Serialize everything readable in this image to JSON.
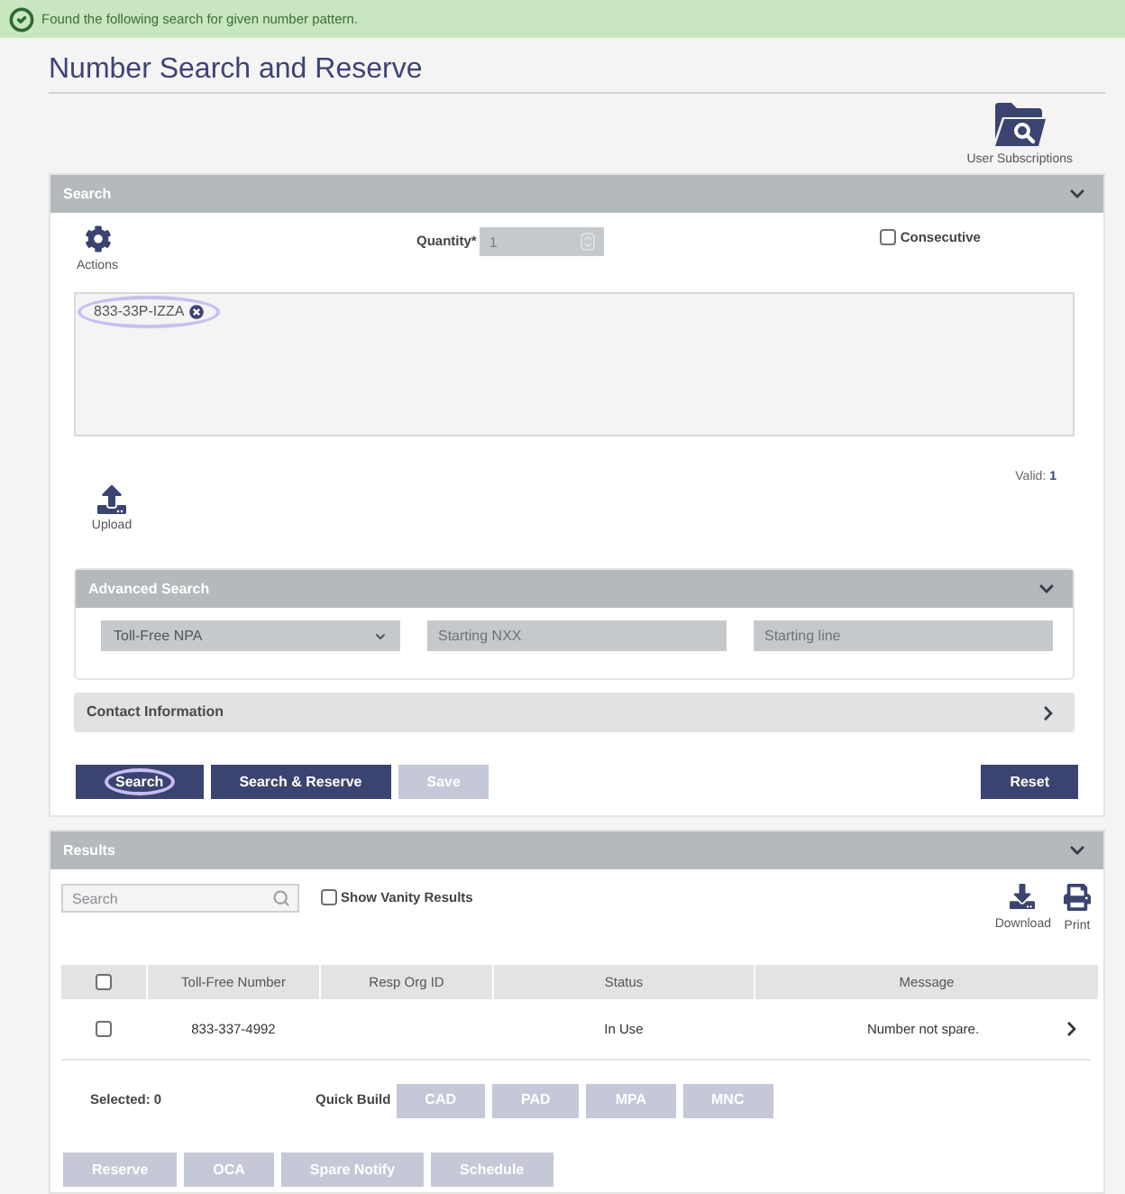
{
  "alert": {
    "kind": "success",
    "message": "Found the following search for given number pattern."
  },
  "page_title": "Number Search and Reserve",
  "header_tools": [
    {
      "kind": "subscriptions",
      "label": "User Subscriptions"
    }
  ],
  "search_panel": {
    "title": "Search",
    "expanded": true,
    "actions_label": "Actions",
    "quantity": {
      "label": "Quantity*",
      "value": "1",
      "disabled": true
    },
    "consecutive": {
      "label": "Consecutive",
      "checked": false
    },
    "patterns": [
      {
        "text": "833-33P-IZZA",
        "focused": true
      }
    ],
    "valid_text": "Valid: **1**",
    "upload_label": "Upload",
    "advanced_search": {
      "title": "Advanced Search",
      "expanded": true,
      "npa_select": {
        "value": "Toll-Free NPA"
      },
      "fields": [
        {
          "placeholder": "Starting NXX"
        },
        {
          "placeholder": "Starting line"
        }
      ]
    },
    "contact_information": {
      "title": "Contact Information",
      "expanded": false
    },
    "buttons": [
      {
        "label": "Search",
        "disabled": false,
        "focused": true
      },
      {
        "label": "Search & Reserve",
        "disabled": false,
        "focused": false
      },
      {
        "label": "Save",
        "disabled": true,
        "focused": false
      }
    ],
    "reset_button": {
      "label": "Reset",
      "disabled": false
    }
  },
  "results_panel": {
    "title": "Results",
    "expanded": true,
    "search": {
      "placeholder": "Search"
    },
    "show_vanity": {
      "label": "Show Vanity Results",
      "checked": false
    },
    "tools": [
      {
        "kind": "download",
        "label": "Download"
      },
      {
        "kind": "print",
        "label": "Print"
      }
    ],
    "table": {
      "select_all_checked": false,
      "columns": [
        "Toll-Free Number",
        "Resp Org ID",
        "Status",
        "Message"
      ],
      "rows": [
        {
          "selected": false,
          "number": "833-337-4992",
          "status": "In Use",
          "message": "Number not spare."
        }
      ]
    },
    "selected_text": "Selected: 0",
    "quick_build": {
      "label": "Quick Build",
      "buttons": [
        {
          "label": "CAD",
          "disabled": true
        },
        {
          "label": "PAD",
          "disabled": true
        },
        {
          "label": "MPA",
          "disabled": true
        },
        {
          "label": "MNC",
          "disabled": true
        }
      ]
    },
    "actions": [
      {
        "label": "Reserve",
        "disabled": true
      },
      {
        "label": "OCA",
        "disabled": true
      },
      {
        "label": "Spare Notify",
        "disabled": true
      },
      {
        "label": "Schedule",
        "disabled": true
      }
    ]
  }
}
